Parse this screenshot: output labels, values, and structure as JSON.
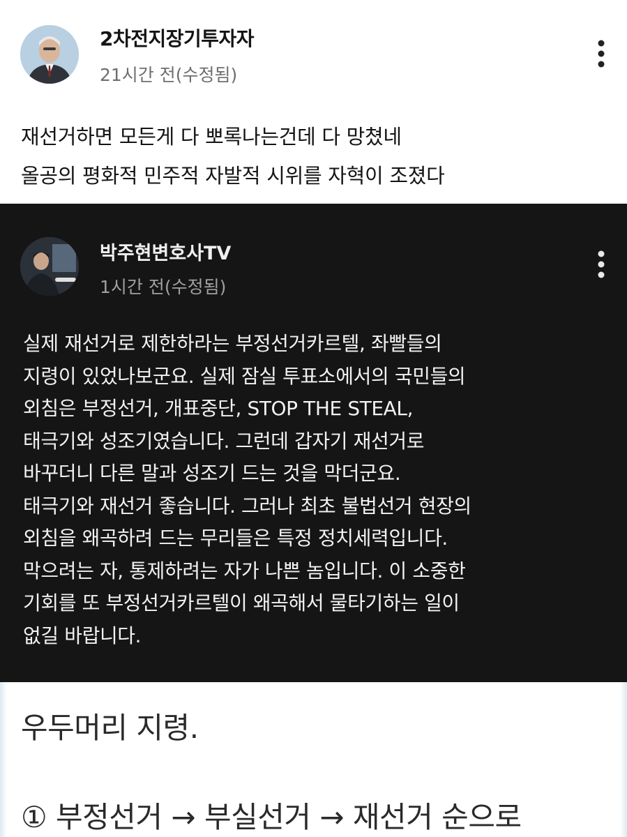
{
  "post": {
    "author": "2차전지장기투자자",
    "time": "21시간 전(수정됨)",
    "body_lines": [
      "재선거하면 모든게 다 뽀록나는건데 다 망쳤네",
      "올공의 평화적 민주적 자발적 시위를 자혁이 조졌다"
    ],
    "more_icon": "more-vert-icon"
  },
  "embed": {
    "author": "박주현변호사TV",
    "time": "1시간 전(수정됨)",
    "body_lines": [
      "실제 재선거로 제한하라는 부정선거카르텔, 좌빨들의",
      "지령이 있었나보군요. 실제 잠실 투표소에서의 국민들의",
      "외침은 부정선거, 개표중단, STOP THE STEAL,",
      "태극기와 성조기였습니다. 그런데 갑자기 재선거로",
      "바꾸더니 다른 말과 성조기 드는 것을 막더군요.",
      "태극기와 재선거 좋습니다. 그러나 최초 불법선거 현장의",
      "외침을 왜곡하려 드는 무리들은 특정 정치세력입니다.",
      "막으려는 자, 통제하려는 자가 나쁜 놈입니다. 이 소중한",
      "기회를 또 부정선거카르텔이 왜곡해서 물타기하는 일이",
      "없길 바랍니다."
    ],
    "more_icon": "more-vert-icon"
  },
  "lower_image": {
    "heading": "우두머리 지령.",
    "step": "① 부정선거 → 부실선거 → 재선거 순으로"
  },
  "colors": {
    "embed_background": "#151515",
    "text_primary": "#141414",
    "text_secondary": "#6e6e6e"
  }
}
